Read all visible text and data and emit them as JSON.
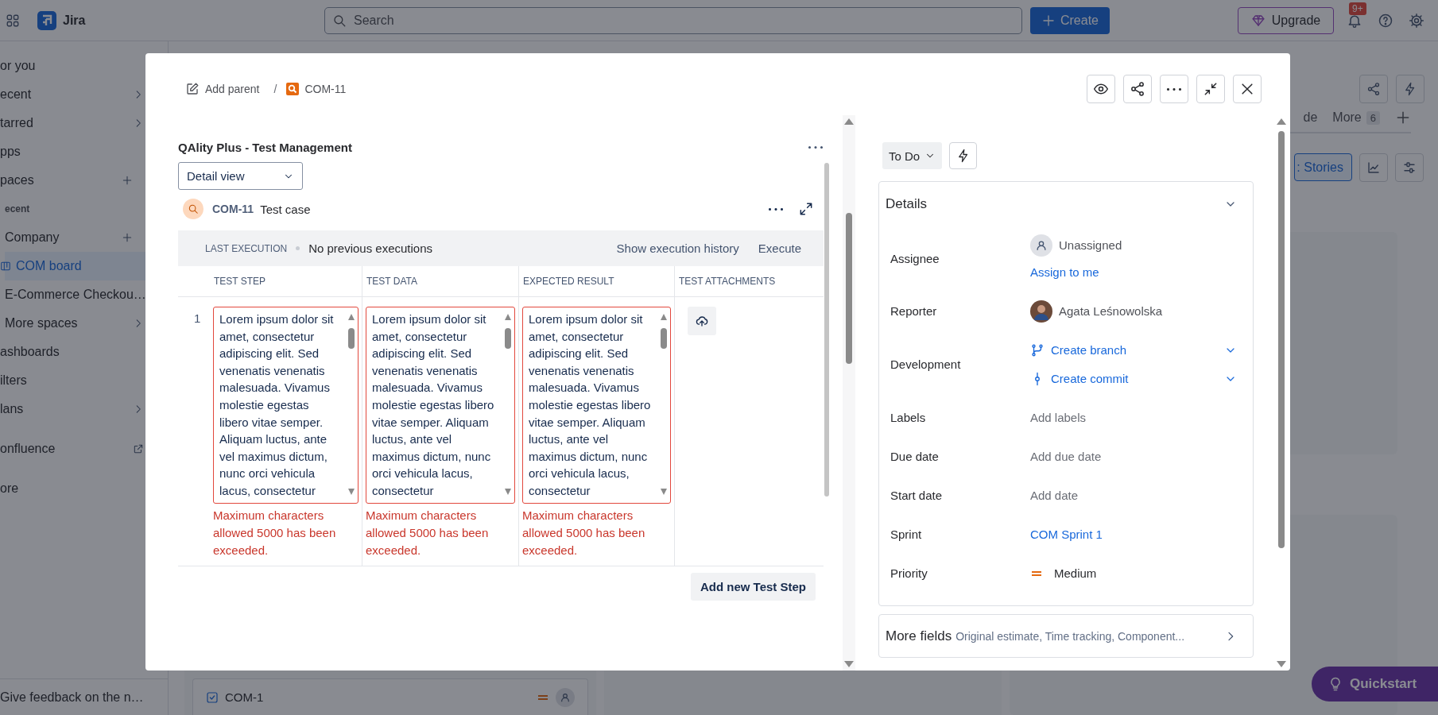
{
  "topbar": {
    "product": "Jira",
    "search": {
      "placeholder": "Search"
    },
    "create_button": "Create",
    "upgrade_button": "Upgrade",
    "notification_badge": "9+"
  },
  "sidebar": {
    "sections": [
      {
        "items": [
          {
            "label": "or you",
            "expandable": false,
            "addable": false,
            "external": false,
            "selected": false
          },
          {
            "label": "ecent",
            "expandable": true,
            "addable": false,
            "external": false,
            "selected": false
          },
          {
            "label": "tarred",
            "expandable": true,
            "addable": false,
            "external": false,
            "selected": false
          },
          {
            "label": "pps",
            "expandable": false,
            "addable": false,
            "external": false,
            "selected": false
          },
          {
            "label": "paces",
            "expandable": false,
            "addable": true,
            "external": false,
            "selected": false,
            "subheading": "ecent",
            "children": [
              {
                "label": "Company",
                "kind": "space",
                "expandable": false,
                "addable": true,
                "external": false,
                "selected": false
              },
              {
                "label": "COM board",
                "kind": "board",
                "expandable": false,
                "addable": false,
                "external": false,
                "selected": true
              },
              {
                "label": "E-Commerce Checkou…",
                "kind": "space",
                "selected": false
              },
              {
                "label": "More spaces",
                "kind": "link",
                "expandable": true,
                "addable": false,
                "external": false,
                "selected": false
              }
            ]
          },
          {
            "label": "ashboards",
            "expandable": false,
            "addable": false,
            "external": false,
            "selected": false
          },
          {
            "label": "ilters",
            "expandable": false,
            "addable": false,
            "external": false,
            "selected": false
          },
          {
            "label": "lans",
            "expandable": true,
            "addable": false,
            "external": false,
            "selected": false
          }
        ]
      },
      {
        "items": [
          {
            "label": "onfluence",
            "expandable": false,
            "addable": false,
            "external": true,
            "selected": false
          }
        ]
      },
      {
        "items": [
          {
            "label": "ore",
            "expandable": false,
            "addable": false,
            "external": false,
            "selected": false
          }
        ]
      }
    ],
    "feedback": "Give feedback on the n…"
  },
  "board": {
    "tabs": [
      {
        "label": "de",
        "selected": false
      },
      {
        "label": "More",
        "count": "6",
        "selected": false
      }
    ],
    "filter_button": ": Stories",
    "card": {
      "key": "COM-1"
    }
  },
  "quickstart": "Quickstart",
  "modal": {
    "breadcrumbs": [
      {
        "label": "Add parent",
        "kind": "add-parent"
      },
      {
        "label": "COM-11",
        "kind": "issue"
      }
    ],
    "breadcrumb_separator": "/",
    "test_panel": {
      "title": "QAlity Plus - Test Management",
      "view_select": "Detail view",
      "issue_key": "COM-11",
      "issue_type": "Test case",
      "last_execution_label": "LAST EXECUTION",
      "last_execution_value": "No previous executions",
      "history_link": "Show execution history",
      "execute_button": "Execute",
      "columns": [
        "TEST STEP",
        "TEST DATA",
        "EXPECTED RESULT",
        "TEST ATTACHMENTS"
      ],
      "steps": [
        {
          "number": "1",
          "cells": [
            {
              "text": "Lorem ipsum dolor sit amet, consectetur adipiscing elit. Sed venenatis venenatis malesuada. Vivamus molestie egestas libero vitae semper. Aliquam luctus, ante vel maximus dictum, nunc orci vehicula lacus, consectetur",
              "invalid": true,
              "error": "Maximum characters allowed 5000 has been exceeded."
            },
            {
              "text": "Lorem ipsum dolor sit amet, consectetur adipiscing elit. Sed venenatis venenatis malesuada. Vivamus molestie egestas libero vitae semper. Aliquam luctus, ante vel maximus dictum, nunc orci vehicula lacus, consectetur",
              "invalid": true,
              "error": "Maximum characters allowed 5000 has been exceeded."
            },
            {
              "text": "Lorem ipsum dolor sit amet, consectetur adipiscing elit. Sed venenatis venenatis malesuada. Vivamus molestie egestas libero vitae semper. Aliquam luctus, ante vel maximus dictum, nunc orci vehicula lacus, consectetur",
              "invalid": true,
              "error": "Maximum characters allowed 5000 has been exceeded."
            }
          ]
        }
      ],
      "add_step_button": "Add new Test Step"
    },
    "status": {
      "label": "To Do"
    },
    "details": {
      "title": "Details",
      "expanded": true,
      "fields": [
        {
          "label": "Assignee",
          "kind": "user",
          "value": "Unassigned",
          "action": "Assign to me"
        },
        {
          "label": "Reporter",
          "kind": "person",
          "value": "Agata Leśnowolska"
        },
        {
          "label": "Development",
          "kind": "dev",
          "links": [
            "Create branch",
            "Create commit"
          ]
        },
        {
          "label": "Labels",
          "kind": "empty",
          "value": "Add labels"
        },
        {
          "label": "Due date",
          "kind": "empty",
          "value": "Add due date"
        },
        {
          "label": "Start date",
          "kind": "empty",
          "value": "Add date"
        },
        {
          "label": "Sprint",
          "kind": "link",
          "value": "COM Sprint 1"
        },
        {
          "label": "Priority",
          "kind": "priority",
          "value": "Medium"
        }
      ]
    },
    "more_fields": {
      "title": "More fields",
      "summary": "Original estimate, Time tracking, Component..."
    }
  }
}
